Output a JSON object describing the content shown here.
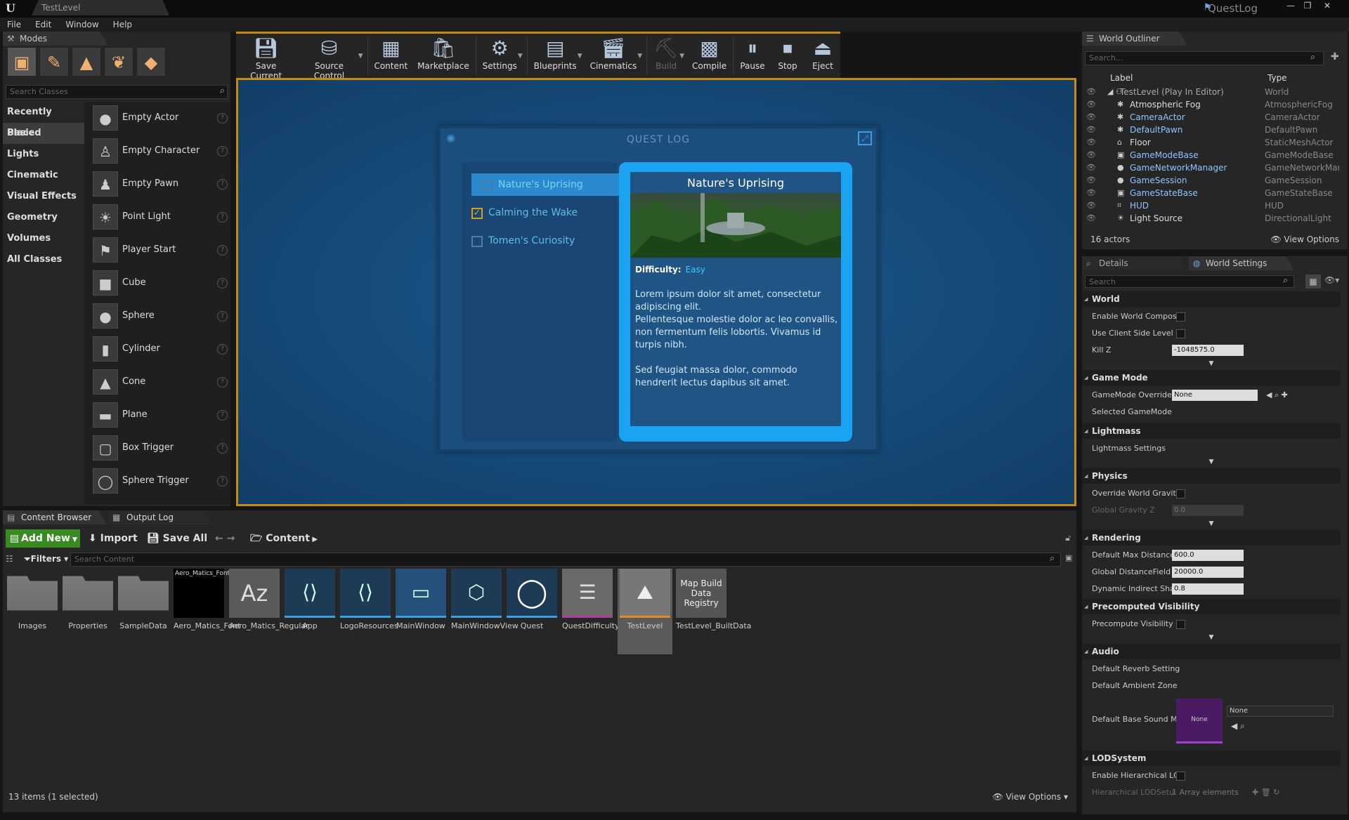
{
  "window": {
    "tab_title": "TestLevel",
    "project_name": "QuestLog",
    "controls": [
      "—",
      "❐",
      "✕"
    ]
  },
  "menu": [
    "File",
    "Edit",
    "Window",
    "Help"
  ],
  "modes": {
    "tab_label": "Modes",
    "mode_icons": [
      "place-icon",
      "paint-icon",
      "landscape-icon",
      "foliage-icon",
      "geometry-edit-icon"
    ],
    "search_placeholder": "Search Classes",
    "categories": [
      "Recently Placed",
      "Basic",
      "Lights",
      "Cinematic",
      "Visual Effects",
      "Geometry",
      "Volumes",
      "All Classes"
    ],
    "selected_category": "Basic",
    "items": [
      "Empty Actor",
      "Empty Character",
      "Empty Pawn",
      "Point Light",
      "Player Start",
      "Cube",
      "Sphere",
      "Cylinder",
      "Cone",
      "Plane",
      "Box Trigger",
      "Sphere Trigger"
    ]
  },
  "toolbar": {
    "buttons": [
      "Save Current",
      "Source Control",
      "Content",
      "Marketplace",
      "Settings",
      "Blueprints",
      "Cinematics",
      "Build",
      "Compile",
      "Pause",
      "Stop",
      "Eject"
    ]
  },
  "quest_log": {
    "title": "QUEST LOG",
    "quests": [
      {
        "name": "Nature's Uprising",
        "checked": false,
        "selected": true
      },
      {
        "name": "Calming the Wake",
        "checked": true,
        "selected": false
      },
      {
        "name": "Tomen's Curiosity",
        "checked": false,
        "selected": false
      }
    ],
    "detail_title": "Nature's Uprising",
    "difficulty_label": "Difficulty:",
    "difficulty_value": "Easy",
    "body_1": "Lorem ipsum dolor sit amet, consectetur adipiscing elit.",
    "body_2": "Pellentesque molestie dolor ac leo convallis, non fermentum felis lobortis. Vivamus id turpis nibh.",
    "body_3": "Sed feugiat massa dolor, commodo hendrerit lectus dapibus sit amet."
  },
  "outliner": {
    "tab_label": "World Outliner",
    "search_placeholder": "Search...",
    "col_label": "Label",
    "col_type": "Type",
    "rows": [
      {
        "label": "TestLevel (Play In Editor)",
        "type": "World",
        "blue": false
      },
      {
        "label": "Atmospheric Fog",
        "type": "AtmosphericFog",
        "blue": false
      },
      {
        "label": "CameraActor",
        "type": "CameraActor",
        "blue": true
      },
      {
        "label": "DefaultPawn",
        "type": "DefaultPawn",
        "blue": true
      },
      {
        "label": "Floor",
        "type": "StaticMeshActor",
        "blue": false
      },
      {
        "label": "GameModeBase",
        "type": "GameModeBase",
        "blue": true
      },
      {
        "label": "GameNetworkManager",
        "type": "GameNetworkMar",
        "blue": true
      },
      {
        "label": "GameSession",
        "type": "GameSession",
        "blue": true
      },
      {
        "label": "GameStateBase",
        "type": "GameStateBase",
        "blue": true
      },
      {
        "label": "HUD",
        "type": "HUD",
        "blue": true
      },
      {
        "label": "Light Source",
        "type": "DirectionalLight",
        "blue": false
      }
    ],
    "actor_count": "16 actors",
    "view_options": "View Options"
  },
  "details": {
    "tab_details": "Details",
    "tab_world_settings": "World Settings",
    "search_placeholder": "Search",
    "sections": {
      "world": "World",
      "game_mode": "Game Mode",
      "lightmass": "Lightmass",
      "physics": "Physics",
      "rendering": "Rendering",
      "precomputed_visibility": "Precomputed Visibility",
      "audio": "Audio",
      "lod_system": "LODSystem"
    },
    "props": {
      "enable_world_compos": "Enable World Composi",
      "use_client_side_level": "Use Client Side Level S",
      "kill_z": "Kill Z",
      "kill_z_value": "-1048575.0",
      "gamemode_override": "GameMode Override",
      "gamemode_override_value": "None",
      "selected_gamemode": "Selected GameMode",
      "lightmass_settings": "Lightmass Settings",
      "override_world_gravity": "Override World Gravity",
      "global_gravity_z": "Global Gravity Z",
      "global_gravity_z_value": "0.0",
      "default_max_distance": "Default Max Distance",
      "default_max_distance_value": "600.0",
      "global_distancefield": "Global DistanceField V",
      "global_distancefield_value": "20000.0",
      "dynamic_indirect": "Dynamic Indirect Shac",
      "dynamic_indirect_value": "0.8",
      "precompute_visibility": "Precompute Visibility",
      "default_reverb": "Default Reverb Setting",
      "default_ambient_zone": "Default Ambient Zone",
      "default_base_sound": "Default Base Sound M",
      "base_sound_thumb": "None",
      "base_sound_value": "None",
      "enable_hierarchical": "Enable Hierarchical LC",
      "hierarchical_lod_setup": "Hierarchical LODSetu",
      "hierarchical_lod_value": "1 Array elements"
    }
  },
  "content_browser": {
    "tab_content_browser": "Content Browser",
    "tab_output_log": "Output Log",
    "add_new": "Add New",
    "import": "Import",
    "save_all": "Save All",
    "path": "Content",
    "filters": "Filters",
    "search_placeholder": "Search Content",
    "assets": [
      {
        "name": "Images",
        "kind": "folder"
      },
      {
        "name": "Properties",
        "kind": "folder"
      },
      {
        "name": "SampleData",
        "kind": "folder"
      },
      {
        "name": "Aero_Matics_Font",
        "kind": "font",
        "thumb_text": "Aero_Matics_Font"
      },
      {
        "name": "Aero_Matics_Regular",
        "kind": "fontface",
        "thumb_text": "Az"
      },
      {
        "name": "App",
        "kind": "widget"
      },
      {
        "name": "LogoResources",
        "kind": "widget"
      },
      {
        "name": "MainWindow",
        "kind": "widget"
      },
      {
        "name": "MainWindowView",
        "kind": "widget"
      },
      {
        "name": "Quest",
        "kind": "object"
      },
      {
        "name": "QuestDifficulty",
        "kind": "enum"
      },
      {
        "name": "TestLevel",
        "kind": "level",
        "selected": true
      },
      {
        "name": "TestLevel_BuiltData",
        "kind": "registry",
        "thumb_text": "Map Build Data Registry"
      }
    ],
    "status": "13 items (1 selected)",
    "view_options": "View Options"
  }
}
